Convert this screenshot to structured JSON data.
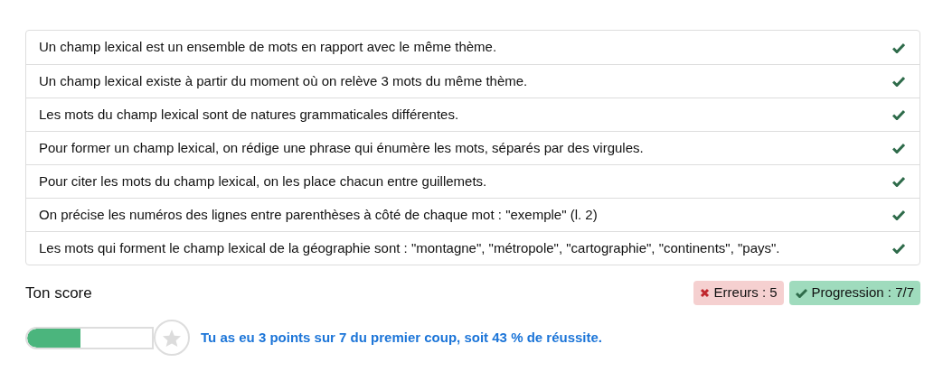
{
  "statements": [
    {
      "text": "Un champ lexical est un ensemble de mots en rapport avec le même thème.",
      "checked": true
    },
    {
      "text": "Un champ lexical existe à partir du moment où on relève 3 mots du même thème.",
      "checked": true
    },
    {
      "text": "Les mots du champ lexical sont de natures grammaticales différentes.",
      "checked": true
    },
    {
      "text": "Pour former un champ lexical, on rédige une phrase qui énumère les mots, séparés par des virgules.",
      "checked": true
    },
    {
      "text": "Pour citer les mots du champ lexical, on les place chacun entre guillemets.",
      "checked": true
    },
    {
      "text": "On précise les numéros des lignes entre parenthèses à côté de chaque mot : \"exemple\" (l. 2)",
      "checked": true
    },
    {
      "text": "Les mots qui forment le champ lexical de la géographie sont : \"montagne\", \"métropole\", \"cartographie\", \"continents\", \"pays\".",
      "checked": true
    }
  ],
  "score": {
    "title": "Ton score",
    "badges": [
      {
        "kind": "errors",
        "label": "Erreurs : 5"
      },
      {
        "kind": "progress",
        "label": "Progression : 7/7"
      }
    ],
    "progress": {
      "level": 0.43
    },
    "message": "Tu as eu 3 points sur 7 du premier coup, soit 43 % de réussite."
  }
}
